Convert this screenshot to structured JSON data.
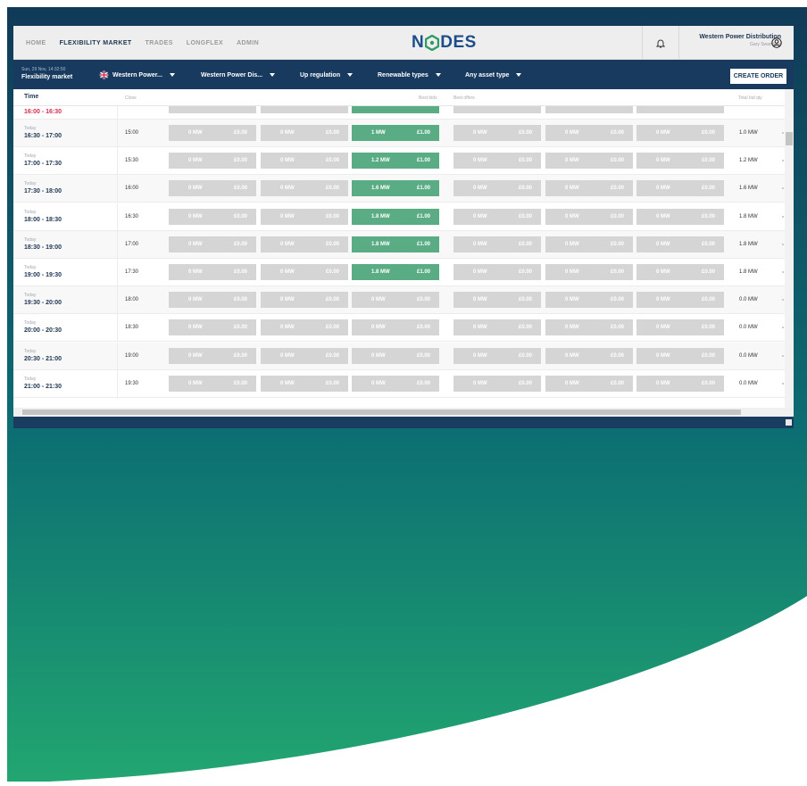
{
  "nav": {
    "links": [
      "HOME",
      "FLEXIBILITY MARKET",
      "TRADES",
      "LONGFLEX",
      "ADMIN"
    ],
    "active_index": 1,
    "logo": "NODES",
    "org_name": "Western Power Distribution",
    "user_name": "Gary Swandells"
  },
  "filters": {
    "datetime": "Sun, 29 Nov, 14:32:50",
    "page_title": "Flexibility market",
    "items": [
      "Western Power...",
      "Western Power Dis...",
      "Up regulation",
      "Renewable types",
      "Any asset type"
    ],
    "create_order": "CREATE ORDER"
  },
  "table": {
    "headers": {
      "time": "Time",
      "close": "Close",
      "best_bids": "Best bids",
      "best_offers": "Best offers",
      "total_bid_qty": "Total bid qty"
    },
    "partial_row": {
      "time": "16:00 - 16:30"
    },
    "rows": [
      {
        "day": "Today",
        "time": "16:30 - 17:00",
        "close": "15:00",
        "bid_mw": "1 MW",
        "bid_price": "£1.00",
        "total": "1.0 MW"
      },
      {
        "day": "Today",
        "time": "17:00 - 17:30",
        "close": "15:30",
        "bid_mw": "1.2 MW",
        "bid_price": "£1.00",
        "total": "1.2 MW"
      },
      {
        "day": "Today",
        "time": "17:30 - 18:00",
        "close": "16:00",
        "bid_mw": "1.6 MW",
        "bid_price": "£1.00",
        "total": "1.6 MW"
      },
      {
        "day": "Today",
        "time": "18:00 - 18:30",
        "close": "16:30",
        "bid_mw": "1.8 MW",
        "bid_price": "£1.00",
        "total": "1.8 MW"
      },
      {
        "day": "Today",
        "time": "18:30 - 19:00",
        "close": "17:00",
        "bid_mw": "1.8 MW",
        "bid_price": "£1.00",
        "total": "1.8 MW"
      },
      {
        "day": "Today",
        "time": "19:00 - 19:30",
        "close": "17:30",
        "bid_mw": "1.8 MW",
        "bid_price": "£1.00",
        "total": "1.8 MW"
      },
      {
        "day": "Today",
        "time": "19:30 - 20:00",
        "close": "18:00",
        "bid_mw": "0 MW",
        "bid_price": "£0.00",
        "total": "0.0 MW"
      },
      {
        "day": "Today",
        "time": "20:00 - 20:30",
        "close": "18:30",
        "bid_mw": "0 MW",
        "bid_price": "£0.00",
        "total": "0.0 MW"
      },
      {
        "day": "Today",
        "time": "20:30 - 21:00",
        "close": "19:00",
        "bid_mw": "0 MW",
        "bid_price": "£0.00",
        "total": "0.0 MW"
      },
      {
        "day": "Today",
        "time": "21:00 - 21:30",
        "close": "19:30",
        "bid_mw": "0 MW",
        "bid_price": "£0.00",
        "total": "0.0 MW"
      }
    ],
    "empty_cell": {
      "mw": "0 MW",
      "price": "£0.00"
    }
  },
  "colors": {
    "navy": "#183a5e",
    "bid_active": "#5aac84",
    "cell_empty": "#d5d5d5",
    "past_time": "#d62b4c"
  }
}
